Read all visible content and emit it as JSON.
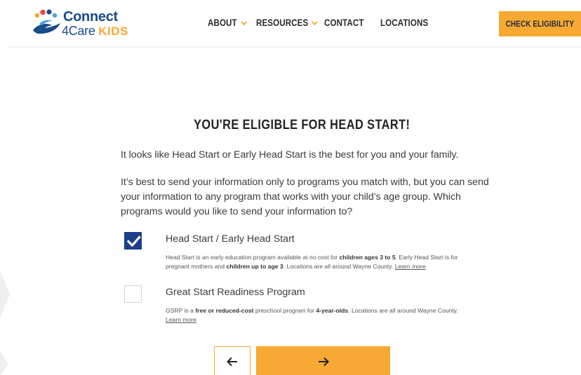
{
  "brand": {
    "line1": "Connect",
    "line2_main": "4Care",
    "line2_accent": "KIDS",
    "colors": {
      "navy": "#1a4b8c",
      "orange": "#f7a933",
      "check_blue": "#1a3f8b"
    }
  },
  "nav": {
    "about": "ABOUT",
    "resources": "RESOURCES",
    "contact": "CONTACT",
    "locations": "LOCATIONS",
    "cta": "CHECK ELIGIBILITY"
  },
  "main": {
    "title": "YOU'RE ELIGIBLE FOR HEAD START!",
    "intro": "It looks like Head Start or Early Head Start is the best for you and your family.",
    "question": "It’s best to send your information only to programs you match with, but you can send your information to any program that works with your child’s age group. Which programs would you like to send your information to?",
    "options": [
      {
        "title": "Head Start / Early Head Start",
        "checked": true,
        "desc_a": "Head Start is an early education program available at no cost for ",
        "desc_b": "children ages 3 to 5",
        "desc_c": ". Early Head Start is for pregnant mothers and ",
        "desc_d": "children up to age 3",
        "desc_e": ". Locations are all around Wayne County. ",
        "link": "Learn more"
      },
      {
        "title": "Great Start Readiness Program",
        "checked": false,
        "desc_a": "GSRP is a ",
        "desc_b": "free or reduced-cost",
        "desc_c": " preschool program for ",
        "desc_d": "4-year-olds",
        "desc_e": ". Locations are all around Wayne County. ",
        "link": "Learn more"
      }
    ],
    "icons": {
      "back": "arrow-left-icon",
      "next": "arrow-right-icon"
    }
  }
}
